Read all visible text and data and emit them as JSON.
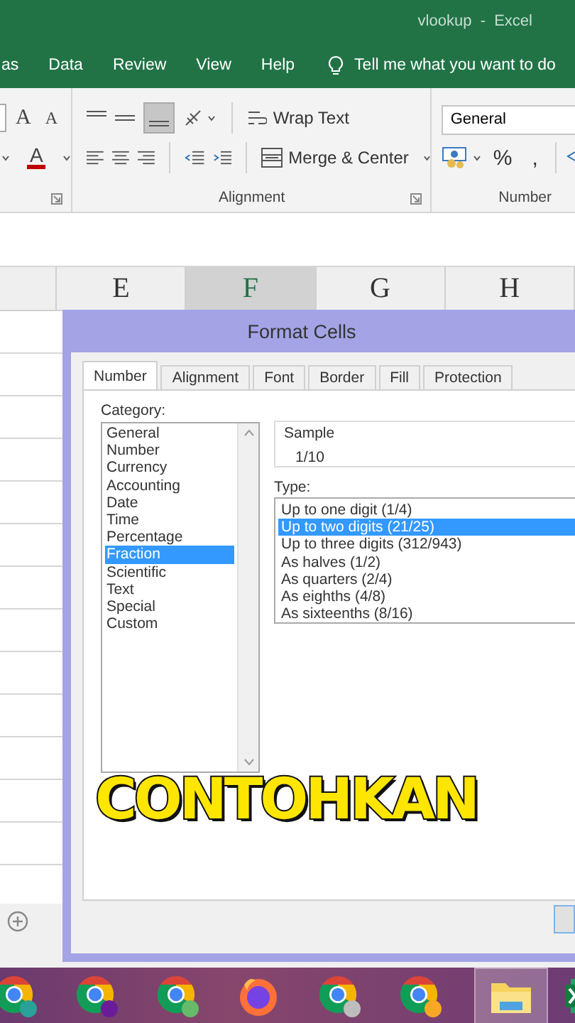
{
  "window": {
    "title": "vlookup  -  Excel"
  },
  "ribbon_tabs": [
    {
      "label": "as"
    },
    {
      "label": "Data"
    },
    {
      "label": "Review"
    },
    {
      "label": "View"
    },
    {
      "label": "Help"
    }
  ],
  "tell_me": "Tell me what you want to do",
  "ribbon": {
    "font_grow": "A",
    "font_shrink": "A",
    "font_color": "A",
    "wrap_text": "Wrap Text",
    "merge_center": "Merge & Center",
    "number_format": "General",
    "percent": "%",
    "comma": ",",
    "groups": [
      "Alignment",
      "Number"
    ]
  },
  "columns": [
    {
      "label": "E",
      "selected": false
    },
    {
      "label": "F",
      "selected": true
    },
    {
      "label": "G",
      "selected": false
    },
    {
      "label": "H",
      "selected": false
    }
  ],
  "dialog": {
    "title": "Format Cells",
    "tabs": [
      {
        "label": "Number",
        "selected": true
      },
      {
        "label": "Alignment",
        "selected": false
      },
      {
        "label": "Font",
        "selected": false
      },
      {
        "label": "Border",
        "selected": false
      },
      {
        "label": "Fill",
        "selected": false
      },
      {
        "label": "Protection",
        "selected": false
      }
    ],
    "category_label": "Category:",
    "categories": [
      {
        "label": "General",
        "selected": false
      },
      {
        "label": "Number",
        "selected": false
      },
      {
        "label": "Currency",
        "selected": false
      },
      {
        "label": "Accounting",
        "selected": false
      },
      {
        "label": "Date",
        "selected": false
      },
      {
        "label": "Time",
        "selected": false
      },
      {
        "label": "Percentage",
        "selected": false
      },
      {
        "label": "Fraction",
        "selected": true
      },
      {
        "label": "Scientific",
        "selected": false
      },
      {
        "label": "Text",
        "selected": false
      },
      {
        "label": "Special",
        "selected": false
      },
      {
        "label": "Custom",
        "selected": false
      }
    ],
    "sample_label": "Sample",
    "sample": "1/10",
    "type_label": "Type:",
    "types": [
      {
        "label": "Up to one digit (1/4)",
        "selected": false
      },
      {
        "label": "Up to two digits (21/25)",
        "selected": true
      },
      {
        "label": "Up to three digits (312/943)",
        "selected": false
      },
      {
        "label": "As halves (1/2)",
        "selected": false
      },
      {
        "label": "As quarters (2/4)",
        "selected": false
      },
      {
        "label": "As eighths (4/8)",
        "selected": false
      },
      {
        "label": "As sixteenths (8/16)",
        "selected": false
      }
    ]
  },
  "caption": "CONTOHKAN"
}
